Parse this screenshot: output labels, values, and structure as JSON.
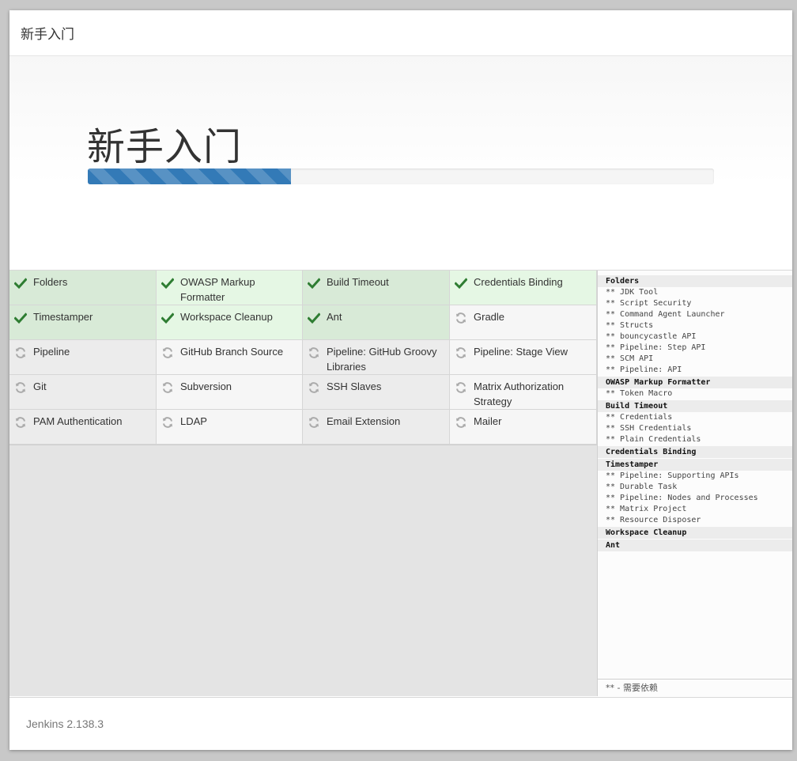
{
  "window": {
    "title": "新手入门"
  },
  "hero": {
    "title": "新手入门",
    "progress_percent": 32.5
  },
  "plugins": [
    {
      "name": "Folders",
      "status": "done"
    },
    {
      "name": "OWASP Markup Formatter",
      "status": "done"
    },
    {
      "name": "Build Timeout",
      "status": "done"
    },
    {
      "name": "Credentials Binding",
      "status": "done"
    },
    {
      "name": "Timestamper",
      "status": "done"
    },
    {
      "name": "Workspace Cleanup",
      "status": "done"
    },
    {
      "name": "Ant",
      "status": "done"
    },
    {
      "name": "Gradle",
      "status": "pending"
    },
    {
      "name": "Pipeline",
      "status": "pending"
    },
    {
      "name": "GitHub Branch Source",
      "status": "pending"
    },
    {
      "name": "Pipeline: GitHub Groovy Libraries",
      "status": "pending"
    },
    {
      "name": "Pipeline: Stage View",
      "status": "pending"
    },
    {
      "name": "Git",
      "status": "pending"
    },
    {
      "name": "Subversion",
      "status": "pending"
    },
    {
      "name": "SSH Slaves",
      "status": "pending"
    },
    {
      "name": "Matrix Authorization Strategy",
      "status": "pending"
    },
    {
      "name": "PAM Authentication",
      "status": "pending"
    },
    {
      "name": "LDAP",
      "status": "pending"
    },
    {
      "name": "Email Extension",
      "status": "pending"
    },
    {
      "name": "Mailer",
      "status": "pending"
    }
  ],
  "log": {
    "lines": [
      {
        "text": "Folders",
        "head": true
      },
      {
        "text": "** JDK Tool",
        "head": false
      },
      {
        "text": "** Script Security",
        "head": false
      },
      {
        "text": "** Command Agent Launcher",
        "head": false
      },
      {
        "text": "** Structs",
        "head": false
      },
      {
        "text": "** bouncycastle API",
        "head": false
      },
      {
        "text": "** Pipeline: Step API",
        "head": false
      },
      {
        "text": "** SCM API",
        "head": false
      },
      {
        "text": "** Pipeline: API",
        "head": false
      },
      {
        "text": "OWASP Markup Formatter",
        "head": true
      },
      {
        "text": "** Token Macro",
        "head": false
      },
      {
        "text": "Build Timeout",
        "head": true
      },
      {
        "text": "** Credentials",
        "head": false
      },
      {
        "text": "** SSH Credentials",
        "head": false
      },
      {
        "text": "** Plain Credentials",
        "head": false
      },
      {
        "text": "Credentials Binding",
        "head": true
      },
      {
        "text": "Timestamper",
        "head": true
      },
      {
        "text": "** Pipeline: Supporting APIs",
        "head": false
      },
      {
        "text": "** Durable Task",
        "head": false
      },
      {
        "text": "** Pipeline: Nodes and Processes",
        "head": false
      },
      {
        "text": "** Matrix Project",
        "head": false
      },
      {
        "text": "** Resource Disposer",
        "head": false
      },
      {
        "text": "Workspace Cleanup",
        "head": true
      },
      {
        "text": "Ant",
        "head": true
      }
    ],
    "footer": "** - 需要依赖"
  },
  "footer": {
    "version": "Jenkins 2.138.3"
  },
  "colors": {
    "check": "#2e7d32",
    "spinner": "#aaaaaa",
    "progress": "#337ab7"
  },
  "icons": {
    "done": "check-icon",
    "pending": "refresh-icon"
  }
}
